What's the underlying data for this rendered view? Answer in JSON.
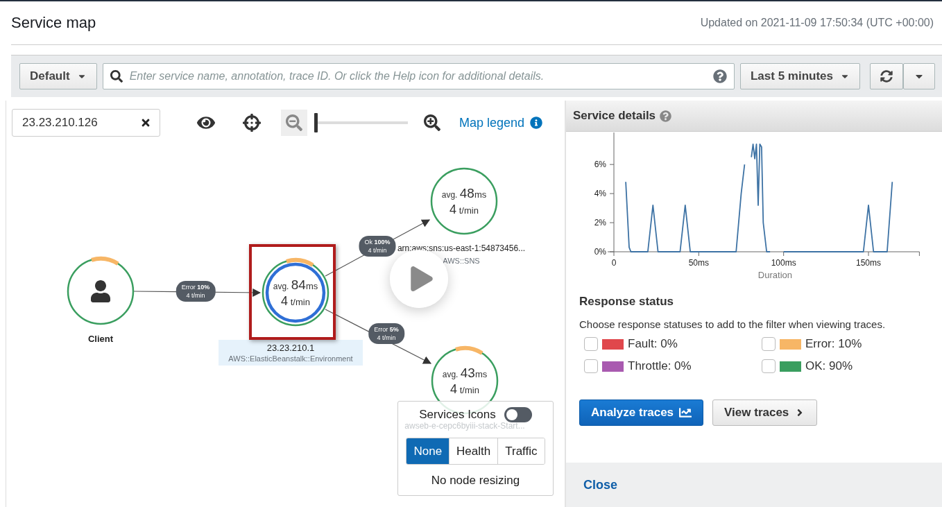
{
  "header": {
    "title": "Service map",
    "updated": "Updated on 2021-11-09 17:50:34 (UTC +00:00)"
  },
  "toolbar": {
    "group": "Default",
    "search": {
      "placeholder": "Enter service name, annotation, trace ID. Or click the Help icon for additional details."
    },
    "time_range": "Last 5 minutes"
  },
  "map": {
    "filter": {
      "value": "23.23.210.126"
    },
    "zoom": {
      "level": 0
    },
    "legend_link": "Map legend",
    "nodes": [
      {
        "kind": "client",
        "name": "Client",
        "error_arc": true,
        "selected": false
      },
      {
        "kind": "service",
        "avg_label": "avg.",
        "avg": "84",
        "avg_unit": "ms",
        "rate": "4",
        "rate_unit": "t/min",
        "name": "23.23.210.1",
        "type": "AWS::ElasticBeanstalk::Environment",
        "error_arc": true,
        "selected": true
      },
      {
        "kind": "service",
        "avg_label": "avg.",
        "avg": "48",
        "avg_unit": "ms",
        "rate": "4",
        "rate_unit": "t/min",
        "name": "arn:aws:sns:us-east-1:54873456...",
        "type": "AWS::SNS",
        "error_arc": false,
        "selected": false
      },
      {
        "kind": "service",
        "avg_label": "avg.",
        "avg": "43",
        "avg_unit": "ms",
        "rate": "4",
        "rate_unit": "t/min",
        "name": "awseb-e-cepc6byiii-stack-Start...",
        "error_arc": true,
        "selected": false
      }
    ],
    "edges": [
      {
        "label": "Error **10%**",
        "rate": "4 t/min"
      },
      {
        "label": "Ok **100%**",
        "rate": "4 t/min"
      },
      {
        "label": "Error **5%**",
        "rate": "4 t/min"
      }
    ]
  },
  "display_panel": {
    "title": "Services Icons",
    "icons_on": false,
    "modes": [
      {
        "label": "None",
        "selected": true
      },
      {
        "label": "Health",
        "selected": false
      },
      {
        "label": "Traffic",
        "selected": false
      }
    ],
    "note": "No node resizing"
  },
  "details": {
    "title": "Service details",
    "chart_data": {
      "type": "line",
      "xlabel": "Duration",
      "xlim": [
        0,
        180
      ],
      "ylim": [
        0,
        8.2
      ],
      "xticks": [
        {
          "value": 0,
          "label": "0"
        },
        {
          "value": 50,
          "label": "50ms"
        },
        {
          "value": 100,
          "label": "100ms"
        },
        {
          "value": 150,
          "label": "150ms"
        }
      ],
      "yticks": [
        {
          "value": 0,
          "label": "0%"
        },
        {
          "value": 2,
          "label": "2%"
        },
        {
          "value": 4,
          "label": "4%"
        },
        {
          "value": 6,
          "label": "6%"
        }
      ],
      "x": [
        7,
        9,
        10,
        20,
        23,
        26,
        39,
        42,
        45,
        72,
        75,
        77,
        79,
        80,
        81,
        82,
        83,
        84,
        85,
        86,
        87,
        88,
        90,
        92,
        95,
        96,
        97,
        98,
        100,
        147,
        150,
        153,
        161,
        164
      ],
      "series": [
        {
          "color": "#3d72a4",
          "values": [
            4.8,
            0.3,
            0,
            0,
            3.2,
            0,
            0,
            3.2,
            0,
            0,
            4,
            6,
            null,
            null,
            6.5,
            7.4,
            6.4,
            7.4,
            3.2,
            7.4,
            7.2,
            2,
            0,
            0,
            null,
            null,
            null,
            null,
            0,
            0,
            3.2,
            0,
            0,
            4.8
          ]
        }
      ]
    },
    "response": {
      "title": "Response status",
      "hint": "Choose response statuses to add to the filter when viewing traces.",
      "statuses": [
        {
          "label": "Fault: 0%",
          "color": "#e0474c",
          "checked": false
        },
        {
          "label": "Error: 10%",
          "color": "#f7b666",
          "checked": false
        },
        {
          "label": "Throttle: 0%",
          "color": "#a95ab0",
          "checked": false
        },
        {
          "label": "OK: 90%",
          "color": "#3a9e5f",
          "checked": false
        }
      ]
    },
    "analyze": "Analyze traces",
    "view": "View traces",
    "close": "Close"
  }
}
